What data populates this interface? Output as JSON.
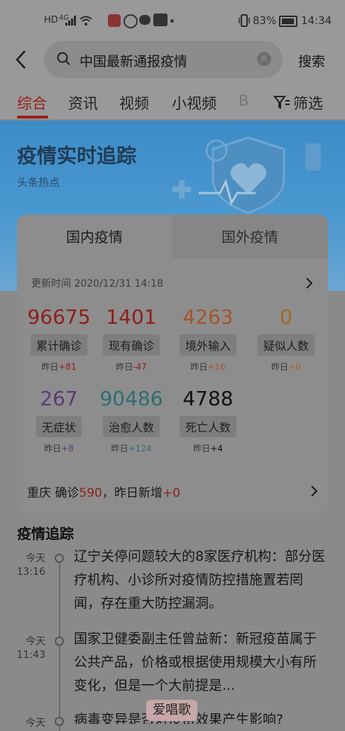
{
  "status": {
    "left_icons": [
      "HD",
      "4G",
      "signal",
      "wifi"
    ],
    "app_icons": [
      "pinduoduo-icon",
      "app-icon",
      "chat-icon",
      "tiktok-icon",
      "more-icon"
    ],
    "battery": "83%",
    "time": "14:34"
  },
  "search": {
    "query": "中国最新通报疫情",
    "action": "搜索"
  },
  "tabs": [
    "综合",
    "资讯",
    "视频",
    "小视频",
    "B",
    "筛选"
  ],
  "banner": {
    "title": "疫情实时追踪",
    "subtitle": "头条热点"
  },
  "card": {
    "tab_domestic": "国内疫情",
    "tab_foreign": "国外疫情",
    "update_time": "更新时间 2020/12/31 14:18",
    "stats": [
      {
        "value": "96675",
        "label": "累计确诊",
        "delta_prefix": "昨日",
        "delta": "+81",
        "color": "#8e1e1a"
      },
      {
        "value": "1401",
        "label": "现有确诊",
        "delta_prefix": "昨日",
        "delta": "-47",
        "color": "#8e1e1a"
      },
      {
        "value": "4263",
        "label": "境外输入",
        "delta_prefix": "昨日",
        "delta": "+16",
        "color": "#a3552b"
      },
      {
        "value": "0",
        "label": "疑似人数",
        "delta_prefix": "昨日",
        "delta": "+0",
        "color": "#a06a1f"
      },
      {
        "value": "267",
        "label": "无症状",
        "delta_prefix": "昨日",
        "delta": "+8",
        "color": "#5c3a78"
      },
      {
        "value": "90486",
        "label": "治愈人数",
        "delta_prefix": "昨日",
        "delta": "+124",
        "color": "#2f6d73"
      },
      {
        "value": "4788",
        "label": "死亡人数",
        "delta_prefix": "昨日",
        "delta": "+4",
        "color": "#111111"
      }
    ],
    "region": {
      "prefix": "重庆 确诊",
      "confirmed": "590",
      "middle": "，昨日新增",
      "new": "+0"
    }
  },
  "tracking": {
    "title": "疫情追踪",
    "items": [
      {
        "day": "今天",
        "time": "13:16",
        "text": "辽宁关停问题较大的8家医疗机构：部分医疗机构、小诊所对疫情防控措施置若罔闻，存在重大防控漏洞。"
      },
      {
        "day": "今天",
        "time": "11:43",
        "text": "国家卫健委副主任曾益新：新冠疫苗属于公共产品，价格或根据使用规模大小有所变化，但是一个大前提是..."
      },
      {
        "day": "今天",
        "time": "",
        "text": "病毒变异是否对疫苗效果产生影响?"
      }
    ]
  },
  "watermark": "爱唱歌"
}
